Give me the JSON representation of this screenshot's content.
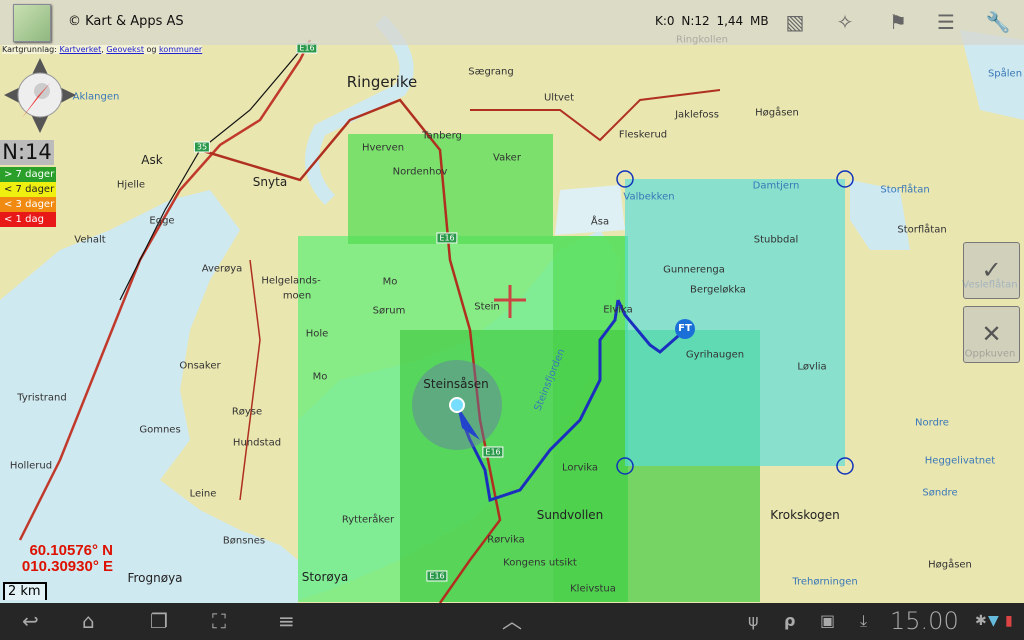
{
  "topbar": {
    "copyright": "© Kart & Apps AS",
    "stats": "K:0  N:12  1,44 MB",
    "icons": [
      "map-layers-icon",
      "gps-target-icon",
      "person-flag-icon",
      "menu-list-icon",
      "settings-wrench-icon"
    ]
  },
  "credit": {
    "prefix": "Kartgrunnlag: ",
    "links": [
      "Kartverket",
      "Geovekst",
      "kommuner"
    ],
    "sep1": ", ",
    "sep2": " og "
  },
  "zoom_level": "N:14",
  "legend": [
    {
      "label": "> 7 dager",
      "color": "#2aa02a"
    },
    {
      "label": "< 7 dager",
      "color": "#f0f010"
    },
    {
      "label": "< 3 dager",
      "color": "#f08a10"
    },
    {
      "label": "< 1 dag",
      "color": "#e81818"
    }
  ],
  "coords": {
    "lat": "60.10576° N",
    "lon": "010.30930° E"
  },
  "scale": "2 km",
  "side_buttons": {
    "confirm": "✓",
    "cancel": "✕"
  },
  "track_markers": {
    "ft": "FT"
  },
  "places": [
    {
      "n": "Ringerike",
      "c": "big"
    },
    {
      "n": "Tanberg"
    },
    {
      "n": "Hverven"
    },
    {
      "n": "Vaker"
    },
    {
      "n": "Nordenhov"
    },
    {
      "n": "Ask",
      "c": "mid"
    },
    {
      "n": "Snyta",
      "c": "mid"
    },
    {
      "n": "Hjelle"
    },
    {
      "n": "Egge"
    },
    {
      "n": "Aklangen",
      "c": "water"
    },
    {
      "n": "Ultvet"
    },
    {
      "n": "Fleskerud"
    },
    {
      "n": "Jaklefoss"
    },
    {
      "n": "Høgåsen"
    },
    {
      "n": "Damtjern",
      "c": "water"
    },
    {
      "n": "Valbekken",
      "c": "water"
    },
    {
      "n": "Åsa"
    },
    {
      "n": "Stubbdal"
    },
    {
      "n": "Storflåtan",
      "c": "water"
    },
    {
      "n": "Storflåtan"
    },
    {
      "n": "Gunnerenga"
    },
    {
      "n": "Bergeløkka"
    },
    {
      "n": "Elvika"
    },
    {
      "n": "Helgelands-"
    },
    {
      "n": "moen"
    },
    {
      "n": "Mo"
    },
    {
      "n": "Sørum"
    },
    {
      "n": "Stein"
    },
    {
      "n": "Hole"
    },
    {
      "n": "Mo"
    },
    {
      "n": "Steinsåsen",
      "c": "mid"
    },
    {
      "n": "Onsaker"
    },
    {
      "n": "Røyse"
    },
    {
      "n": "Averøya"
    },
    {
      "n": "Vehalt"
    },
    {
      "n": "Tyristrand"
    },
    {
      "n": "Gomnes"
    },
    {
      "n": "Hollerud"
    },
    {
      "n": "Hundstad"
    },
    {
      "n": "Leine"
    },
    {
      "n": "Lorvika"
    },
    {
      "n": "Gyrihaugen"
    },
    {
      "n": "Løvlia"
    },
    {
      "n": "Nordre",
      "c": "water"
    },
    {
      "n": "Heggelivatnet",
      "c": "water"
    },
    {
      "n": "Søndre",
      "c": "water"
    },
    {
      "n": "Sundvollen",
      "c": "mid"
    },
    {
      "n": "Krokskogen",
      "c": "mid"
    },
    {
      "n": "Rytteråker"
    },
    {
      "n": "Bønsnes"
    },
    {
      "n": "Storøya",
      "c": "mid"
    },
    {
      "n": "Frognøya",
      "c": "mid"
    },
    {
      "n": "Rørvika"
    },
    {
      "n": "Kongens utsikt"
    },
    {
      "n": "Kleivstua"
    },
    {
      "n": "Trehørningen",
      "c": "water"
    },
    {
      "n": "Høgåsen"
    },
    {
      "n": "Spålen",
      "c": "water"
    },
    {
      "n": "Vesleflåtan",
      "c": "water"
    },
    {
      "n": "Oppkuven"
    },
    {
      "n": "Sægrang"
    },
    {
      "n": "Ringkollen"
    },
    {
      "n": "Steinsfjorden",
      "c": "water"
    }
  ],
  "road_labels": [
    "E16",
    "35",
    "E16",
    "E16",
    "E16"
  ],
  "navbar": {
    "time": "15.00"
  }
}
